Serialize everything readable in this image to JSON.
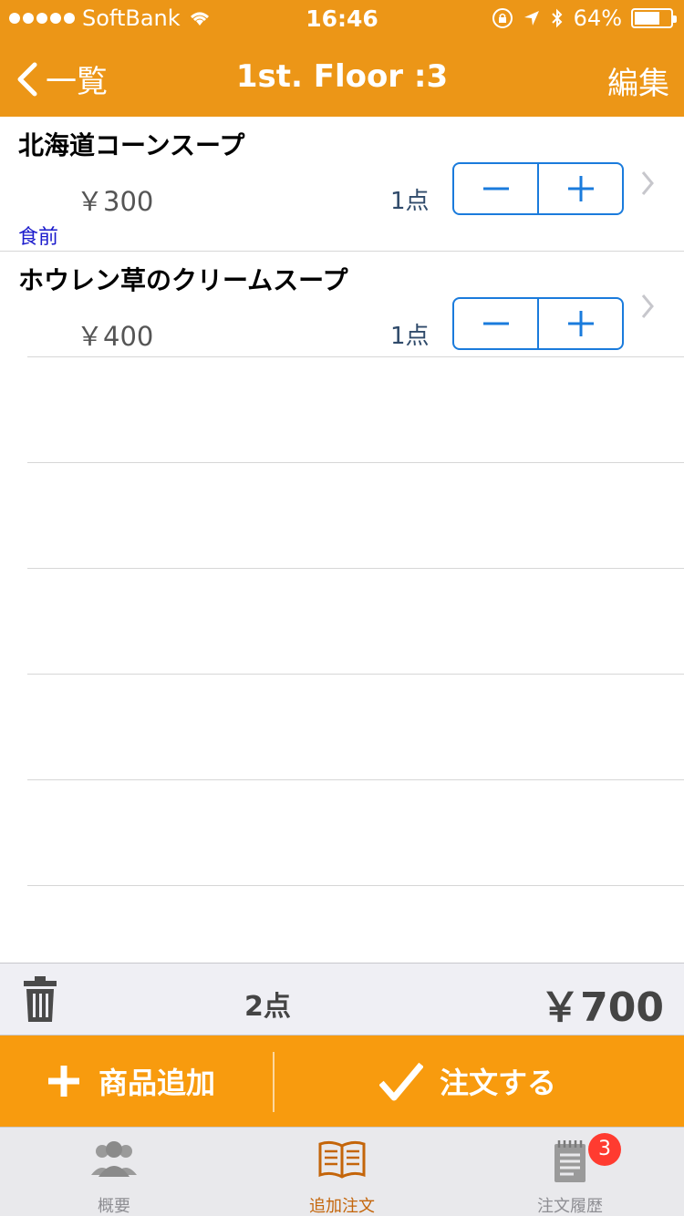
{
  "status": {
    "carrier": "SoftBank",
    "time": "16:46",
    "battery": "64%",
    "battery_level": 0.64
  },
  "nav": {
    "back_label": "一覧",
    "title": "1st. Floor :3",
    "edit_label": "編集"
  },
  "items": [
    {
      "name": "北海道コーンスープ",
      "price": "￥300",
      "qty": "1点",
      "note": "食前"
    },
    {
      "name": "ホウレン草のクリームスープ",
      "price": "￥400",
      "qty": "1点",
      "note": ""
    }
  ],
  "summary": {
    "count": "2点",
    "total": "￥700"
  },
  "actions": {
    "add_label": "商品追加",
    "order_label": "注文する"
  },
  "tabs": [
    {
      "label": "概要",
      "icon": "people-icon",
      "active": false
    },
    {
      "label": "追加注文",
      "icon": "book-icon",
      "active": true
    },
    {
      "label": "注文履歴",
      "icon": "notepad-icon",
      "active": false,
      "badge": "3"
    }
  ],
  "colors": {
    "nav": "#ec9617",
    "action": "#f89b0e",
    "accent": "#1a7bdc",
    "active_tab": "#c4650a",
    "badge": "#ff3b30"
  }
}
